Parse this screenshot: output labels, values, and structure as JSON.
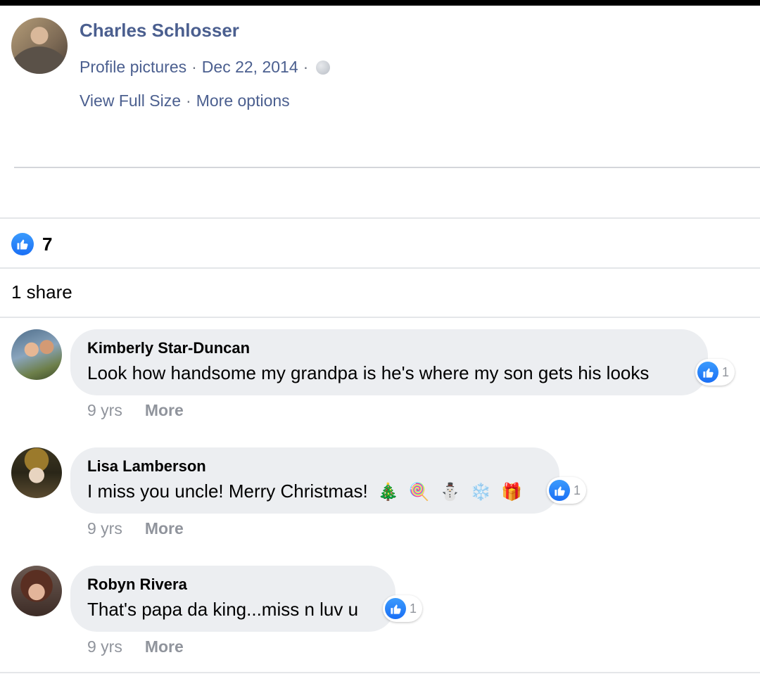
{
  "post": {
    "author": "Charles Schlosser",
    "album": "Profile pictures",
    "separator": "·",
    "date": "Dec 22, 2014",
    "privacy_icon": "globe-icon",
    "view_full_size": "View Full Size",
    "more_options": "More options"
  },
  "stats": {
    "like_icon": "like-icon",
    "likes": "7",
    "shares": "1 share"
  },
  "comments": [
    {
      "author": "Kimberly Star-Duncan",
      "text": "Look how handsome my grandpa is he's where my son gets his looks",
      "reaction_count": "1",
      "time": "9 yrs",
      "more": "More"
    },
    {
      "author": "Lisa Lamberson",
      "text": "I miss you uncle! Merry Christmas!",
      "emojis": [
        "🎄",
        "🍭",
        "⛄",
        "❄️",
        "🎁"
      ],
      "reaction_count": "1",
      "time": "9 yrs",
      "more": "More"
    },
    {
      "author": "Robyn Rivera",
      "text": "That's papa da king...miss n luv u",
      "reaction_count": "1",
      "time": "9 yrs",
      "more": "More"
    }
  ],
  "colors": {
    "link": "#4b5f8f",
    "like_blue": "#1a6ff5",
    "bubble": "#eceef1",
    "muted": "#90949c"
  }
}
